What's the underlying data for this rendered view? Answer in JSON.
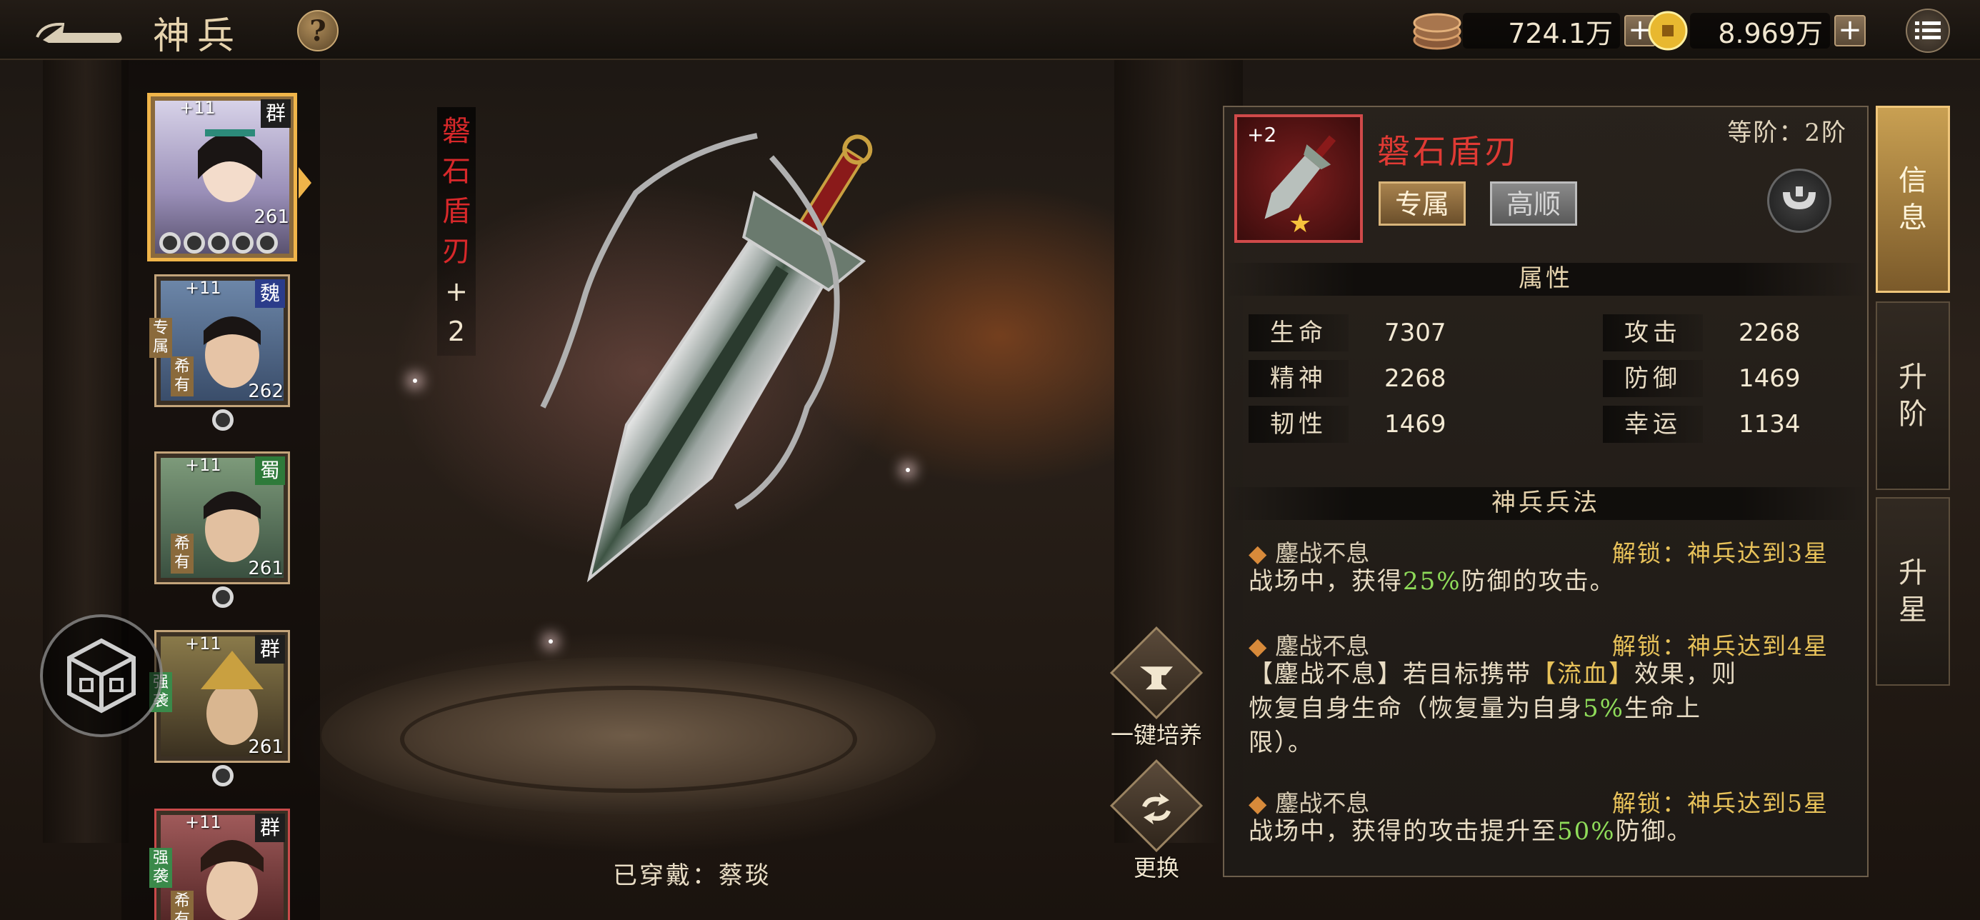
{
  "header": {
    "title": "神兵",
    "help_label": "?",
    "copper": "724.1万",
    "gold": "8.969万",
    "plus_label": "+"
  },
  "heroes": [
    {
      "plus": "+11",
      "faction": "群",
      "level": "261",
      "selected": true,
      "stars": 5,
      "tags": []
    },
    {
      "plus": "+11",
      "faction": "魏",
      "level": "262",
      "selected": false,
      "stars": 1,
      "tags": [
        "专属",
        "希有"
      ]
    },
    {
      "plus": "+11",
      "faction": "蜀",
      "level": "261",
      "selected": false,
      "stars": 1,
      "tags": [
        "希有"
      ]
    },
    {
      "plus": "+11",
      "faction": "群",
      "level": "261",
      "selected": false,
      "stars": 1,
      "tags": [
        "强袭"
      ]
    },
    {
      "plus": "+11",
      "faction": "群",
      "level": "",
      "selected": false,
      "stars": 0,
      "tags": [
        "强袭",
        "希有"
      ]
    }
  ],
  "weapon": {
    "vertical_name_chars": [
      "磐",
      "石",
      "盾",
      "刃"
    ],
    "plus_sign": "+",
    "plus_level": "2",
    "worn_by": "已穿戴：蔡琰"
  },
  "actions": {
    "cultivate_label": "一键培养",
    "replace_label": "更换"
  },
  "info": {
    "item_plus": "+2",
    "item_name": "磐石盾刃",
    "grade": "等阶：2阶",
    "badge_exclusive": "专属",
    "badge_gaoshun": "高顺",
    "attributes_title": "属性",
    "attributes": [
      {
        "label": "生命",
        "value": "7307"
      },
      {
        "label": "攻击",
        "value": "2268"
      },
      {
        "label": "精神",
        "value": "2268"
      },
      {
        "label": "防御",
        "value": "1469"
      },
      {
        "label": "韧性",
        "value": "1469"
      },
      {
        "label": "幸运",
        "value": "1134"
      }
    ],
    "skills_title": "神兵兵法",
    "skills": [
      {
        "name": "鏖战不息",
        "unlock": "解锁：神兵达到3星",
        "desc_a": "战场中，获得",
        "desc_hl": "25%",
        "desc_b": "防御的攻击。"
      },
      {
        "name": "鏖战不息",
        "unlock": "解锁：神兵达到4星",
        "desc_l1a": "【鏖战不息】若目标携带",
        "desc_l1b": "【流血】",
        "desc_l1c": "效果，则",
        "desc_l2a": "恢复自身生命（恢复量为自身",
        "desc_l2hl": "5%",
        "desc_l2b": "生命上",
        "desc_l3": "限）。"
      },
      {
        "name": "鏖战不息",
        "unlock": "解锁：神兵达到5星",
        "desc_a": "战场中，获得的攻击提升至",
        "desc_hl": "50%",
        "desc_b": "防御。"
      }
    ]
  },
  "tabs": [
    {
      "label_top": "信",
      "label_bottom": "息",
      "active": true
    },
    {
      "label_top": "升",
      "label_bottom": "阶",
      "active": false
    },
    {
      "label_top": "升",
      "label_bottom": "星",
      "active": false
    }
  ],
  "colors": {
    "accent_gold": "#f0b54a",
    "item_name_red": "#e03a34",
    "unlock_yellow": "#e8c25a",
    "highlight_green": "#8fdc5a"
  }
}
